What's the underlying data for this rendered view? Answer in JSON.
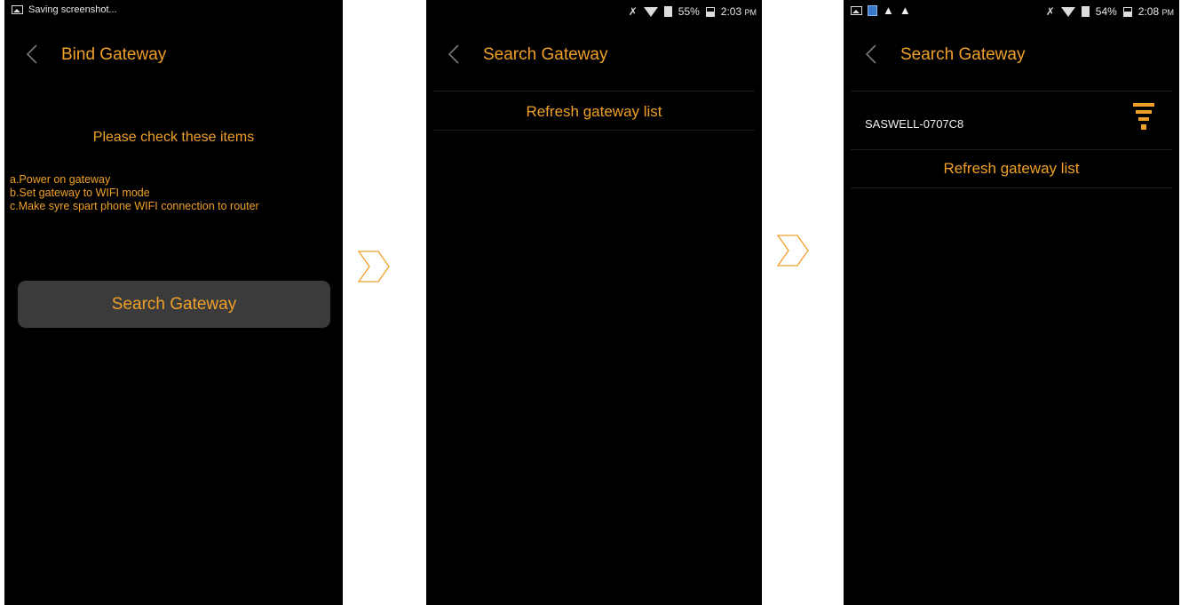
{
  "screen1": {
    "status_text": "Saving screenshot...",
    "title": "Bind Gateway",
    "check_title": "Please check these items",
    "instructions": [
      "a.Power on gateway",
      "b.Set gateway to WIFI mode",
      "c.Make syre spart phone WIFI connection to router"
    ],
    "search_button": "Search Gateway"
  },
  "screen2": {
    "status": {
      "battery": "55%",
      "time": "2:03",
      "ampm": "PM"
    },
    "title": "Search Gateway",
    "refresh": "Refresh gateway list"
  },
  "screen3": {
    "status": {
      "battery": "54%",
      "time": "2:08",
      "ampm": "PM"
    },
    "title": "Search Gateway",
    "gateway_name": "SASWELL-0707C8",
    "refresh": "Refresh gateway list"
  },
  "colors": {
    "accent": "#f0a028",
    "screen_bg": "#000000",
    "button_bg": "#3b3b3b"
  },
  "icons": [
    "back-icon",
    "wifi-icon",
    "battery-icon",
    "signal-icon",
    "chevron-right-icon"
  ]
}
